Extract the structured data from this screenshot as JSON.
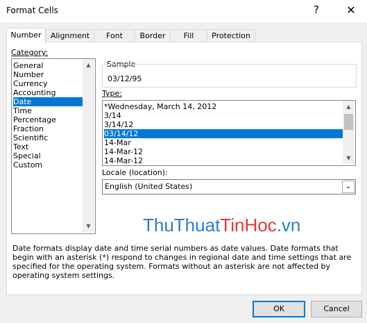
{
  "window": {
    "title": "Format Cells",
    "help": "?",
    "close": "✕"
  },
  "tabs": [
    {
      "label": "Number"
    },
    {
      "label": "Alignment"
    },
    {
      "label": "Font"
    },
    {
      "label": "Border"
    },
    {
      "label": "Fill"
    },
    {
      "label": "Protection"
    }
  ],
  "category": {
    "label": "Category:",
    "items": [
      "General",
      "Number",
      "Currency",
      "Accounting",
      "Date",
      "Time",
      "Percentage",
      "Fraction",
      "Scientific",
      "Text",
      "Special",
      "Custom"
    ],
    "selected": "Date"
  },
  "sample": {
    "label": "Sample",
    "value": "03/12/95"
  },
  "type": {
    "label": "Type:",
    "items": [
      "*Wednesday, March 14, 2012",
      "3/14",
      "3/14/12",
      "03/14/12",
      "14-Mar",
      "14-Mar-12",
      "14-Mar-12"
    ],
    "selected": "03/14/12"
  },
  "locale": {
    "label": "Locale (location):",
    "value": "English (United States)"
  },
  "description": "Date formats display date and time serial numbers as date values.  Date formats that begin with an asterisk (*) respond to changes in regional date and time settings that are specified for the operating system. Formats without an asterisk are not affected by operating system settings.",
  "watermark": {
    "part1": "ThuThuat",
    "part2": "TinHoc",
    "part3": ".vn"
  },
  "buttons": {
    "ok": "OK",
    "cancel": "Cancel"
  },
  "colors": {
    "selection": "#0078d7",
    "dialog_bg": "#f0f0f0"
  }
}
